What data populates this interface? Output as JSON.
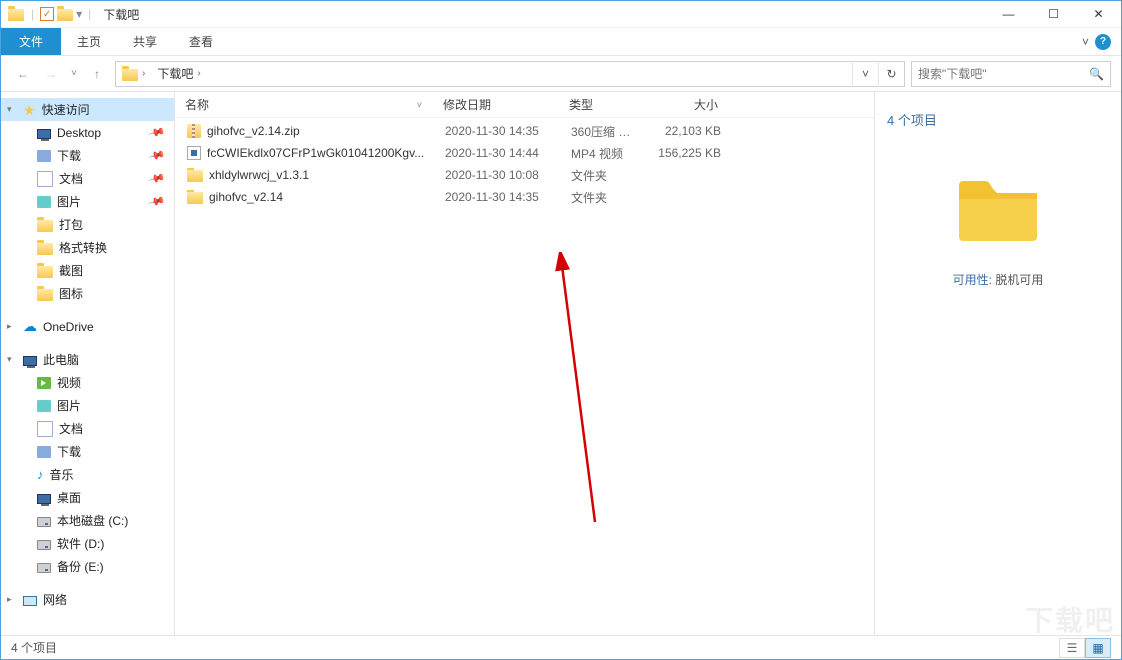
{
  "window": {
    "title": "下载吧",
    "min": "—",
    "max": "☐",
    "close": "✕"
  },
  "ribbon": {
    "file": "文件",
    "tabs": [
      "主页",
      "共享",
      "查看"
    ],
    "expand": "˅"
  },
  "nav": {
    "back": "←",
    "forward": "→",
    "recent": "˅",
    "up": "↑"
  },
  "address": {
    "root": "下载吧",
    "refresh": "↻",
    "dropdown": "˅"
  },
  "search": {
    "placeholder": "搜索\"下载吧\"",
    "icon": "🔍"
  },
  "columns": {
    "name": "名称",
    "date": "修改日期",
    "type": "类型",
    "size": "大小",
    "sort": "˅"
  },
  "files": [
    {
      "icon": "zip",
      "name": "gihofvc_v2.14.zip",
      "date": "2020-11-30 14:35",
      "type": "360压缩 Z...",
      "size": "22,103 KB"
    },
    {
      "icon": "mp4",
      "name": "fcCWIEkdlx07CFrP1wGk01041200Kgv...",
      "date": "2020-11-30 14:44",
      "type": "MP4 视频",
      "size": "156,225 KB"
    },
    {
      "icon": "folder",
      "name": "xhldylwrwcj_v1.3.1",
      "date": "2020-11-30 10:08",
      "type": "文件夹",
      "size": ""
    },
    {
      "icon": "folder",
      "name": "gihofvc_v2.14",
      "date": "2020-11-30 14:35",
      "type": "文件夹",
      "size": ""
    }
  ],
  "sidebar": {
    "quick": "快速访问",
    "quick_items": [
      "Desktop",
      "下载",
      "文档",
      "图片",
      "打包",
      "格式转换",
      "截图",
      "图标"
    ],
    "onedrive": "OneDrive",
    "thispc": "此电脑",
    "pc_items": [
      "视频",
      "图片",
      "文档",
      "下载",
      "音乐",
      "桌面",
      "本地磁盘 (C:)",
      "软件 (D:)",
      "备份 (E:)"
    ],
    "network": "网络"
  },
  "preview": {
    "title": "4 个项目",
    "avail_label": "可用性:",
    "avail_value": "脱机可用"
  },
  "status": {
    "text": "4 个项目"
  },
  "watermark": "下载吧"
}
